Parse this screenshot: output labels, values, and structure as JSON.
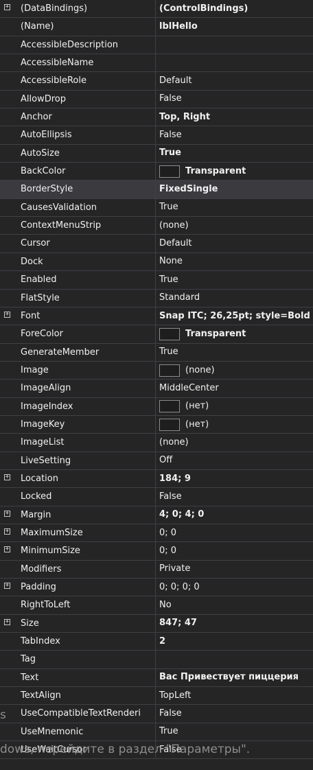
{
  "properties": [
    {
      "name": "(DataBindings)",
      "value": "(ControlBindings)",
      "bold": true,
      "expandable": true
    },
    {
      "name": "(Name)",
      "value": "lblHello",
      "bold": true
    },
    {
      "name": "AccessibleDescription",
      "value": ""
    },
    {
      "name": "AccessibleName",
      "value": ""
    },
    {
      "name": "AccessibleRole",
      "value": "Default"
    },
    {
      "name": "AllowDrop",
      "value": "False"
    },
    {
      "name": "Anchor",
      "value": "Top, Right",
      "bold": true
    },
    {
      "name": "AutoEllipsis",
      "value": "False"
    },
    {
      "name": "AutoSize",
      "value": "True",
      "bold": true
    },
    {
      "name": "BackColor",
      "value": "Transparent",
      "bold": true,
      "swatch": true
    },
    {
      "name": "BorderStyle",
      "value": "FixedSingle",
      "bold": true
    },
    {
      "name": "CausesValidation",
      "value": "True"
    },
    {
      "name": "ContextMenuStrip",
      "value": "(none)"
    },
    {
      "name": "Cursor",
      "value": "Default"
    },
    {
      "name": "Dock",
      "value": "None"
    },
    {
      "name": "Enabled",
      "value": "True"
    },
    {
      "name": "FlatStyle",
      "value": "Standard"
    },
    {
      "name": "Font",
      "value": "Snap ITC; 26,25pt; style=Bold",
      "bold": true,
      "expandable": true
    },
    {
      "name": "ForeColor",
      "value": "Transparent",
      "bold": true,
      "swatch": true
    },
    {
      "name": "GenerateMember",
      "value": "True"
    },
    {
      "name": "Image",
      "value": "(none)",
      "swatch": true
    },
    {
      "name": "ImageAlign",
      "value": "MiddleCenter"
    },
    {
      "name": "ImageIndex",
      "value": "(нет)",
      "swatch": true
    },
    {
      "name": "ImageKey",
      "value": "(нет)",
      "swatch": true
    },
    {
      "name": "ImageList",
      "value": "(none)"
    },
    {
      "name": "LiveSetting",
      "value": "Off"
    },
    {
      "name": "Location",
      "value": "184; 9",
      "bold": true,
      "expandable": true
    },
    {
      "name": "Locked",
      "value": "False"
    },
    {
      "name": "Margin",
      "value": "4; 0; 4; 0",
      "bold": true,
      "expandable": true
    },
    {
      "name": "MaximumSize",
      "value": "0; 0",
      "expandable": true
    },
    {
      "name": "MinimumSize",
      "value": "0; 0",
      "expandable": true
    },
    {
      "name": "Modifiers",
      "value": "Private"
    },
    {
      "name": "Padding",
      "value": "0; 0; 0; 0",
      "expandable": true
    },
    {
      "name": "RightToLeft",
      "value": "No"
    },
    {
      "name": "Size",
      "value": "847; 47",
      "bold": true,
      "expandable": true
    },
    {
      "name": "TabIndex",
      "value": "2",
      "bold": true
    },
    {
      "name": "Tag",
      "value": ""
    },
    {
      "name": "Text",
      "value": "Вас Привествует пиццерия",
      "bold": true
    },
    {
      "name": "TextAlign",
      "value": "TopLeft"
    },
    {
      "name": "UseCompatibleTextRenderi",
      "value": "False"
    },
    {
      "name": "UseMnemonic",
      "value": "True"
    },
    {
      "name": "UseWaitCursor",
      "value": "False"
    }
  ],
  "expander_glyph": "+",
  "watermark": {
    "line1": "s",
    "line2": "dows, перейдите в раздел \"Параметры\"."
  },
  "colors": {
    "background": "#252526",
    "grid_line": "#3f3f46",
    "text": "#f1f1f1"
  }
}
